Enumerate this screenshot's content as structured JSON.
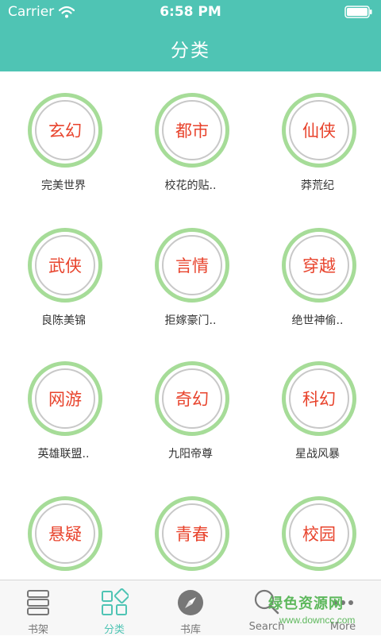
{
  "status_bar": {
    "carrier": "Carrier",
    "time": "6:58 PM"
  },
  "nav": {
    "title": "分类"
  },
  "categories": [
    {
      "name": "玄幻",
      "book": "完美世界"
    },
    {
      "name": "都市",
      "book": "校花的贴.."
    },
    {
      "name": "仙侠",
      "book": "莽荒纪"
    },
    {
      "name": "武侠",
      "book": "良陈美锦"
    },
    {
      "name": "言情",
      "book": "拒嫁豪门.."
    },
    {
      "name": "穿越",
      "book": "绝世神偷.."
    },
    {
      "name": "网游",
      "book": "英雄联盟.."
    },
    {
      "name": "奇幻",
      "book": "九阳帝尊"
    },
    {
      "name": "科幻",
      "book": "星战风暴"
    },
    {
      "name": "悬疑",
      "book": ""
    },
    {
      "name": "青春",
      "book": ""
    },
    {
      "name": "校园",
      "book": ""
    }
  ],
  "tabs": [
    {
      "label": "书架",
      "icon": "bookshelf-icon"
    },
    {
      "label": "分类",
      "icon": "category-icon",
      "active": true
    },
    {
      "label": "书库",
      "icon": "compass-icon"
    },
    {
      "label": "Search",
      "icon": "search-icon"
    },
    {
      "label": "More",
      "icon": "more-icon"
    }
  ],
  "watermark": {
    "logo": "绿色资源网",
    "url": "www.downcc.com"
  },
  "colors": {
    "header": "#4fc4b4",
    "ring": "#a6dc98",
    "category_text": "#e8432c",
    "active_tab": "#4fc4b4"
  }
}
